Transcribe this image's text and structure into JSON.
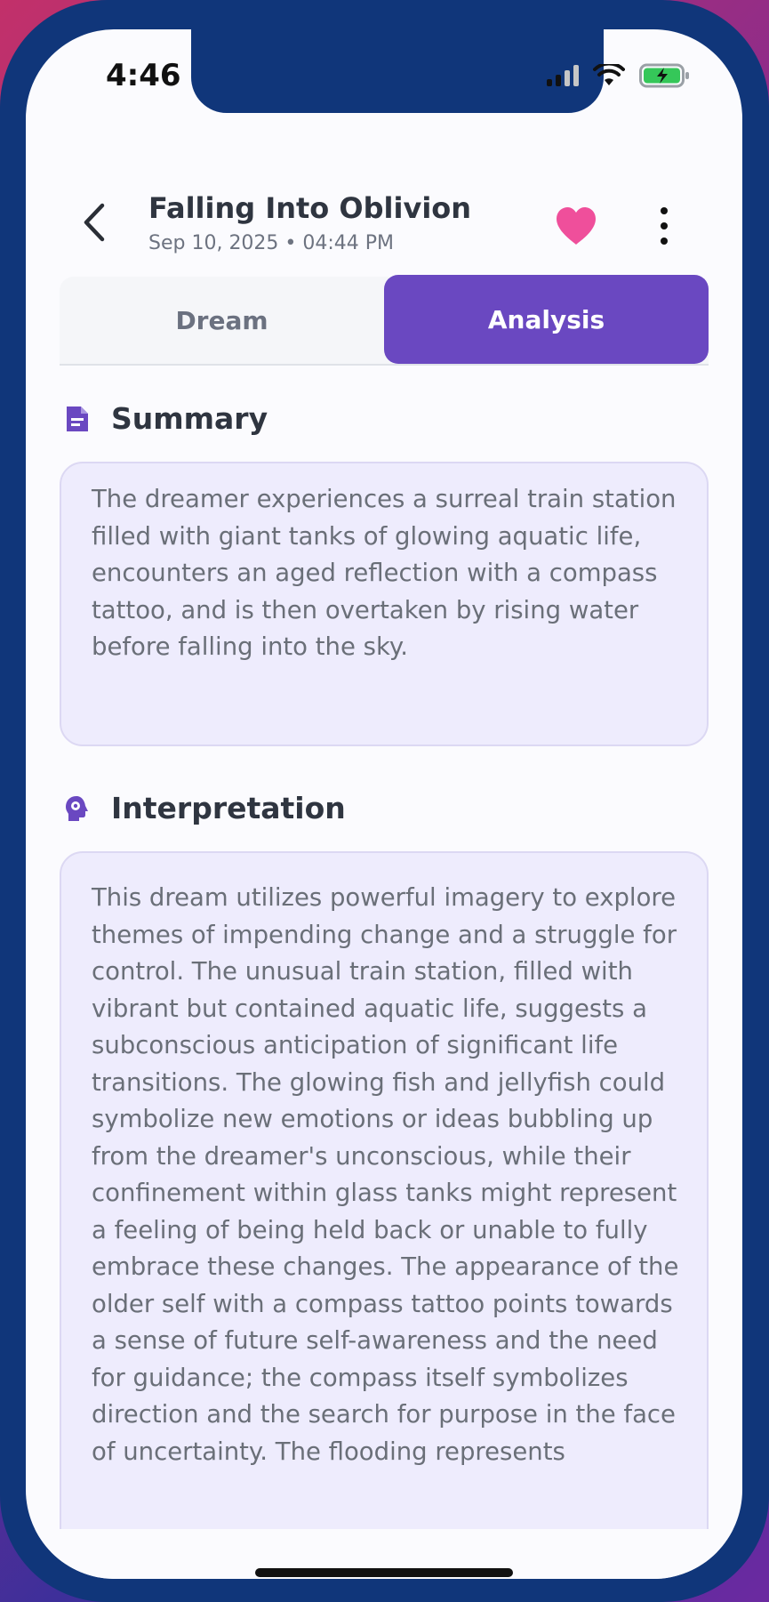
{
  "status_bar": {
    "time": "4:46"
  },
  "header": {
    "title": "Falling Into Oblivion",
    "subtitle": "Sep 10, 2025 • 04:44 PM",
    "favorite_color": "#ef4f9b"
  },
  "tabs": [
    {
      "label": "Dream",
      "active": false
    },
    {
      "label": "Analysis",
      "active": true
    }
  ],
  "accent_color": "#6a48c1",
  "summary": {
    "heading": "Summary",
    "icon": "document-icon",
    "text": "The dreamer experiences a surreal train station filled with giant tanks of glowing aquatic life, encounters an aged reflection with a compass tattoo, and is then overtaken by rising water before falling into the sky."
  },
  "interpretation": {
    "heading": "Interpretation",
    "icon": "psychology-head-icon",
    "text": "This dream utilizes powerful imagery to explore themes of impending change and a struggle for control. The unusual train station, filled with vibrant but contained aquatic life, suggests a subconscious anticipation of significant life transitions. The glowing fish and jellyfish could symbolize new emotions or ideas bubbling up from the dreamer's unconscious, while their confinement within glass tanks might represent a feeling of being held back or unable to fully embrace these changes. The appearance of the older self with a compass tattoo points towards a sense of future self-awareness and the need for guidance; the compass itself symbolizes direction and the search for purpose in the face of uncertainty. The flooding represents"
  }
}
